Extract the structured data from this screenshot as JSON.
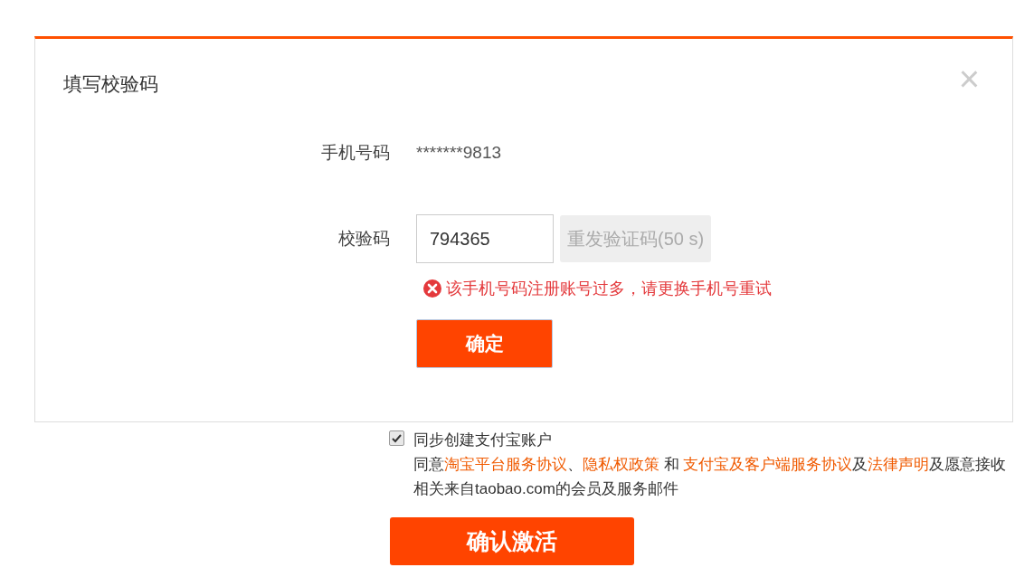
{
  "dialog": {
    "title": "填写校验码",
    "close": "×",
    "phone": {
      "label": "手机号码",
      "value": "*******9813"
    },
    "code": {
      "label": "校验码",
      "value": "794365",
      "resend": {
        "label": "重发验证码(50 s)",
        "disabled": true
      }
    },
    "error": "该手机号码注册账号过多，请更换手机号重试",
    "confirm": "确定"
  },
  "alipay": {
    "label": "同步创建支付宝账户",
    "checked": true
  },
  "agreement": [
    {
      "kind": "text",
      "text": "同意"
    },
    {
      "kind": "link",
      "text": "淘宝平台服务协议"
    },
    {
      "kind": "text",
      "text": "、"
    },
    {
      "kind": "link",
      "text": "隐私权政策"
    },
    {
      "kind": "text",
      "text": " 和 "
    },
    {
      "kind": "link",
      "text": "支付宝及客户端服务协议"
    },
    {
      "kind": "text",
      "text": "及"
    },
    {
      "kind": "link",
      "text": "法律声明"
    },
    {
      "kind": "text",
      "text": "及愿意接收相关来自taobao.com的会员及服务邮件"
    }
  ],
  "activate": "确认激活"
}
